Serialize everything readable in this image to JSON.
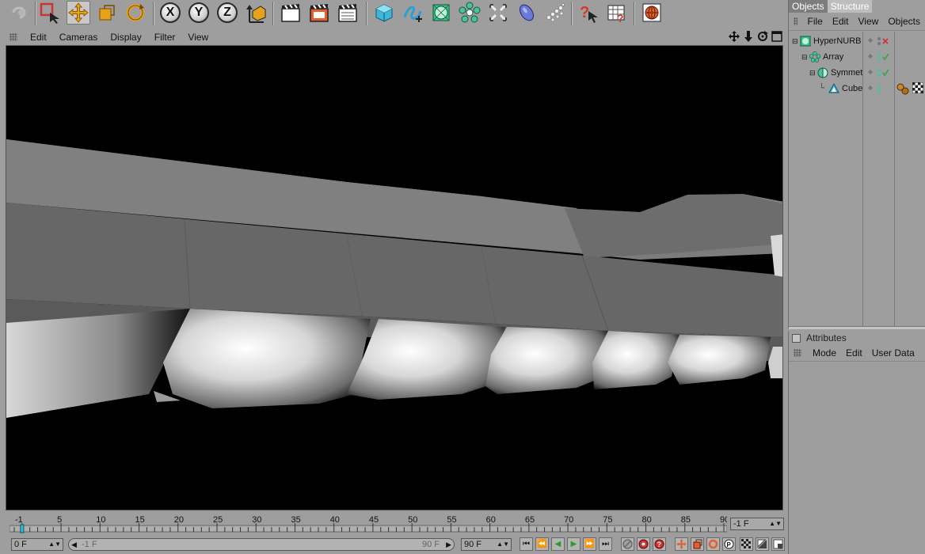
{
  "toolbar": {
    "buttons": [
      {
        "icon": "undo-icon"
      },
      {
        "icon": "live-selection-icon"
      },
      {
        "icon": "move-icon"
      },
      {
        "icon": "scale-icon"
      },
      {
        "icon": "rotate-icon"
      },
      {
        "icon": "x-axis-icon",
        "label": "X"
      },
      {
        "icon": "y-axis-icon",
        "label": "Y"
      },
      {
        "icon": "z-axis-icon",
        "label": "Z"
      },
      {
        "icon": "coordinate-system-icon"
      },
      {
        "icon": "render-view-icon"
      },
      {
        "icon": "render-picture-viewer-icon"
      },
      {
        "icon": "render-settings-icon"
      },
      {
        "icon": "cube-primitive-icon"
      },
      {
        "icon": "spline-pen-icon"
      },
      {
        "icon": "subdivision-surface-icon"
      },
      {
        "icon": "array-generator-icon"
      },
      {
        "icon": "deformer-icon"
      },
      {
        "icon": "scene-object-icon"
      },
      {
        "icon": "particles-icon"
      },
      {
        "icon": "help-icon"
      },
      {
        "icon": "timeline-icon"
      },
      {
        "icon": "web-browser-icon"
      }
    ]
  },
  "viewport": {
    "menu": [
      "Edit",
      "Cameras",
      "Display",
      "Filter",
      "View"
    ],
    "nav_icons": [
      "pan-icon",
      "dolly-icon",
      "orbit-icon",
      "maximize-icon"
    ]
  },
  "objects_panel": {
    "tabs": {
      "objects": "Objects",
      "structure": "Structure"
    },
    "menu": [
      "File",
      "Edit",
      "View",
      "Objects"
    ],
    "tree": [
      {
        "name": "HyperNURB",
        "icon": "hypernurbs-icon",
        "level": 0,
        "check": "x"
      },
      {
        "name": "Array",
        "icon": "array-icon",
        "level": 1,
        "check": "check"
      },
      {
        "name": "Symmet",
        "icon": "symmetry-icon",
        "level": 2,
        "check": "check"
      },
      {
        "name": "Cube",
        "icon": "cube-icon",
        "level": 3,
        "check": "",
        "tags": [
          "material-tag-icon",
          "checker-tag-icon"
        ]
      }
    ]
  },
  "attributes_panel": {
    "title": "Attributes",
    "menu": [
      "Mode",
      "Edit",
      "User Data"
    ]
  },
  "timeline": {
    "ticks": [
      "-1",
      "5",
      "10",
      "15",
      "20",
      "25",
      "30",
      "35",
      "40",
      "45",
      "50",
      "55",
      "60",
      "65",
      "70",
      "75",
      "80",
      "85",
      "90"
    ],
    "end_field": "-1 F",
    "current_frame": "0 F",
    "slider_start": "-1 F",
    "slider_end": "90 F",
    "max_frame": "90 F"
  },
  "playback": {
    "buttons": [
      "go-start-icon",
      "prev-frame-icon",
      "play-backward-icon",
      "play-forward-icon",
      "next-frame-icon",
      "go-end-icon"
    ],
    "record_buttons": [
      "record-icon",
      "autokey-icon",
      "keyframe-selection-icon"
    ],
    "key_buttons": [
      "key-position-icon",
      "key-scale-icon",
      "key-rotation-icon",
      "key-parameter-icon",
      "key-pla-icon",
      "timeline-window-icon"
    ]
  },
  "colors": {
    "ui_gray": "#9e9e9e",
    "viewport_bg": "#000000",
    "active_tab": "#7d7d7d",
    "play_green": "#3aa33a",
    "record_red": "#d03030"
  }
}
